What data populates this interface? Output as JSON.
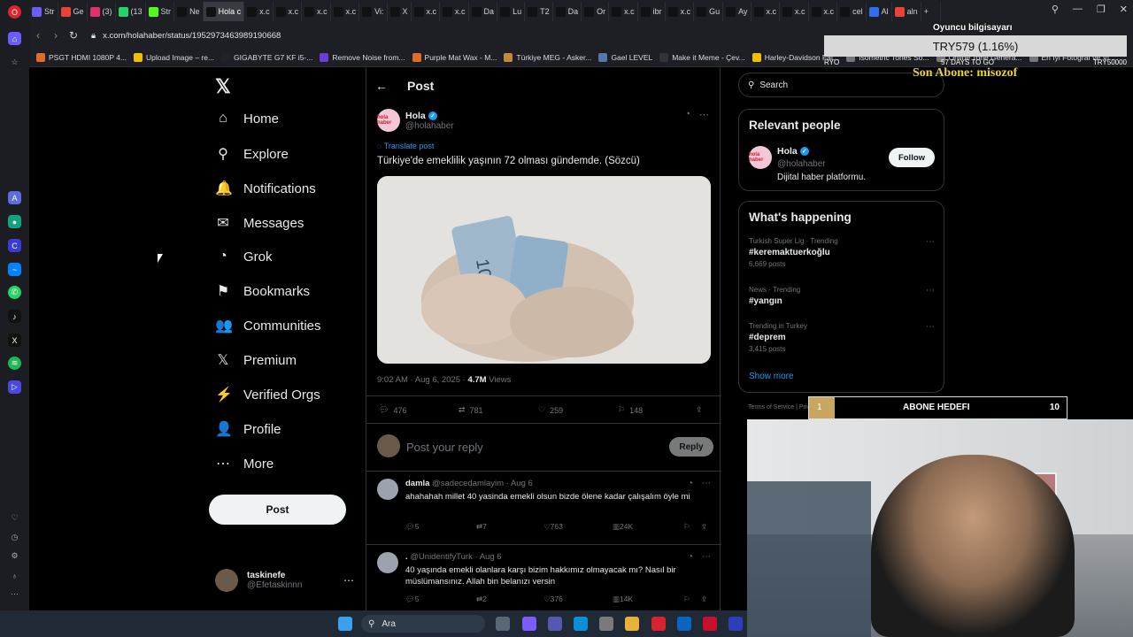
{
  "browser": {
    "tabs": [
      {
        "label": "Str",
        "color": "#6b5cff"
      },
      {
        "label": "Ge",
        "color": "#ea4335"
      },
      {
        "label": "(3)",
        "color": "#e1306c"
      },
      {
        "label": "(13",
        "color": "#25d366"
      },
      {
        "label": "Str",
        "color": "#53fc18"
      },
      {
        "label": "Ne",
        "color": "#111111"
      },
      {
        "label": "Hola c",
        "color": "#111111"
      },
      {
        "label": "x.c",
        "color": "#111111"
      },
      {
        "label": "x.c",
        "color": "#111111"
      },
      {
        "label": "x.c",
        "color": "#111111"
      },
      {
        "label": "x.c",
        "color": "#111111"
      },
      {
        "label": "Vi:",
        "color": "#111111"
      },
      {
        "label": "X",
        "color": "#111111"
      },
      {
        "label": "x.c",
        "color": "#111111"
      },
      {
        "label": "x.c",
        "color": "#111111"
      },
      {
        "label": "Da",
        "color": "#111111"
      },
      {
        "label": "Lu",
        "color": "#111111"
      },
      {
        "label": "T2",
        "color": "#111111"
      },
      {
        "label": "Da",
        "color": "#111111"
      },
      {
        "label": "Or",
        "color": "#111111"
      },
      {
        "label": "x.c",
        "color": "#111111"
      },
      {
        "label": "ibr",
        "color": "#111111"
      },
      {
        "label": "x.c",
        "color": "#111111"
      },
      {
        "label": "Gu",
        "color": "#111111"
      },
      {
        "label": "Ay",
        "color": "#111111"
      },
      {
        "label": "x.c",
        "color": "#111111"
      },
      {
        "label": "x.c",
        "color": "#111111"
      },
      {
        "label": "x.c",
        "color": "#111111"
      },
      {
        "label": "cel",
        "color": "#111111"
      },
      {
        "label": "Al",
        "color": "#2f6fed"
      },
      {
        "label": "aln",
        "color": "#ea4335"
      }
    ],
    "active_tab_index": 6,
    "new_tab": "+",
    "url": "x.com/holahaber/status/1952973463989190668",
    "bookmarks": [
      {
        "label": "PSGT HDMI 1080P 4...",
        "color": "#e06c2a"
      },
      {
        "label": "Upload Image – re...",
        "color": "#f0c000"
      },
      {
        "label": "GIGABYTE G7 KF i5-...",
        "color": "#222222"
      },
      {
        "label": "Remove Noise from...",
        "color": "#6a3fd8"
      },
      {
        "label": "Purple Mat Wax - M...",
        "color": "#e06c2a"
      },
      {
        "label": "Türkiye MEG - Asker...",
        "color": "#c08a3a"
      },
      {
        "label": "Gael LEVEL",
        "color": "#5577aa"
      },
      {
        "label": "Make it Meme - Çev...",
        "color": "#333333"
      },
      {
        "label": "Harley-Davidson Fat...",
        "color": "#f0c000"
      },
      {
        "label": "Isometric Tones So...",
        "color": "#777777"
      },
      {
        "label": "Online Tone Genera...",
        "color": "#777777"
      },
      {
        "label": "En İyi Fotoğraf ve Vi...",
        "color": "#777777"
      }
    ]
  },
  "nav": {
    "items": [
      {
        "label": "Home",
        "icon": "⌂",
        "name": "home"
      },
      {
        "label": "Explore",
        "icon": "⚲",
        "name": "explore"
      },
      {
        "label": "Notifications",
        "icon": "🔔",
        "name": "notifications"
      },
      {
        "label": "Messages",
        "icon": "✉",
        "name": "messages"
      },
      {
        "label": "Grok",
        "icon": "◔",
        "name": "grok"
      },
      {
        "label": "Bookmarks",
        "icon": "⚑",
        "name": "bookmarks"
      },
      {
        "label": "Communities",
        "icon": "👥",
        "name": "communities"
      },
      {
        "label": "Premium",
        "icon": "𝕏",
        "name": "premium"
      },
      {
        "label": "Verified Orgs",
        "icon": "⚡",
        "name": "verified-orgs"
      },
      {
        "label": "Profile",
        "icon": "👤",
        "name": "profile"
      },
      {
        "label": "More",
        "icon": "⋯",
        "name": "more"
      }
    ],
    "post_button": "Post",
    "me": {
      "name": "taskinefe",
      "handle": "@Efetaskinnn"
    }
  },
  "post": {
    "header_title": "Post",
    "author_name": "Hola",
    "author_handle": "@holahaber",
    "avatar_text": "hola haber",
    "translate": "Translate post",
    "text": "Türkiye'de emeklilik yaşının 72 olması gündemde. (Sözcü)",
    "time": "9:02 AM · Aug 6, 2025 · ",
    "views_count": "4.7M",
    "views_label": " Views",
    "stats": {
      "replies": "476",
      "reposts": "781",
      "likes": "259",
      "bookmarks": "148"
    },
    "reply_placeholder": "Post your reply",
    "reply_button": "Reply"
  },
  "replies": [
    {
      "name": "damla",
      "handle": " @sadecedamlayim · Aug 6",
      "text": "ahahahah millet 40 yasinda emekli olsun bizde ölene kadar çalışalım öyle mi",
      "replies": "5",
      "reposts": "7",
      "likes": "763",
      "views": "24K"
    },
    {
      "name": ".",
      "handle": " @UnidentifyTurk · Aug 6",
      "text": "40 yaşında emekli olanlara karşı bizim hakkımız olmayacak mı? Nasıl bir müslümansınız. Allah bin belanızı versin",
      "replies": "5",
      "reposts": "2",
      "likes": "376",
      "views": "14K"
    }
  ],
  "sidebar": {
    "search_placeholder": "Search",
    "relevant_title": "Relevant people",
    "person": {
      "name": "Hola",
      "handle": "@holahaber",
      "bio": "Dijital haber platformu.",
      "follow": "Follow"
    },
    "happening_title": "What's happening",
    "trends": [
      {
        "context": "Turkish Super Lig · Trending",
        "tag": "#keremaktuerkoğlu",
        "count": "6,669 posts"
      },
      {
        "context": "News · Trending",
        "tag": "#yangın",
        "count": ""
      },
      {
        "context": "Trending in Turkey",
        "tag": "#deprem",
        "count": "3,415 posts"
      }
    ],
    "show_more": "Show more",
    "footer": "Terms of Service  |  Privacy Policy  |  Cookie Policy"
  },
  "overlay": {
    "top_label": "Oyuncu bilgisayarı",
    "top_value": "TRY579 (1.16%)",
    "ticker_left": "RYO",
    "ticker_mid": "57 DAYS TO GO",
    "ticker_right": "TRY50000",
    "son_abone": "Son Abone: misozof",
    "abone_label": "ABONE HEDEFI",
    "abone_current": "1",
    "abone_goal": "10",
    "abone_fraction": 0.1
  },
  "taskbar": {
    "search": "Ara"
  }
}
